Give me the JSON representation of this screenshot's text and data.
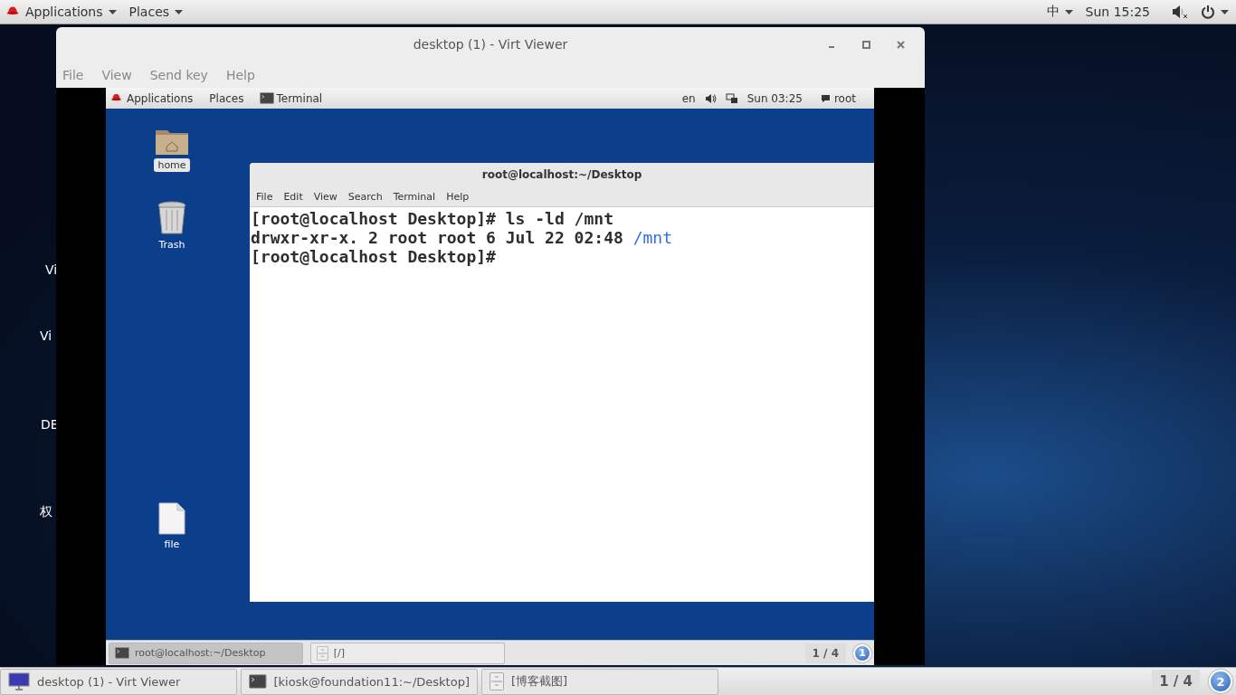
{
  "top_bar": {
    "applications": "Applications",
    "places": "Places",
    "input_method": "中",
    "clock": "Sun 15:25"
  },
  "desktop_cut_labels": [
    {
      "label": "Vi"
    },
    {
      "label": "Vi"
    },
    {
      "label": "DE"
    },
    {
      "label": "权"
    }
  ],
  "virt_viewer": {
    "title": "desktop (1) - Virt Viewer",
    "menu": [
      "File",
      "View",
      "Send key",
      "Help"
    ],
    "guest": {
      "top_bar": {
        "applications": "Applications",
        "places": "Places",
        "task": "Terminal",
        "language": "en",
        "clock": "Sun 03:25",
        "user": "root"
      },
      "desktop_icons": [
        {
          "label": "home",
          "kind": "folder",
          "selected": true
        },
        {
          "label": "Trash",
          "kind": "trash",
          "selected": false
        },
        {
          "label": "file",
          "kind": "file",
          "selected": false
        }
      ],
      "terminal": {
        "title": "root@localhost:~/Desktop",
        "menu": [
          "File",
          "Edit",
          "View",
          "Search",
          "Terminal",
          "Help"
        ],
        "lines": [
          [
            {
              "text": "[root@localhost Desktop]# ls -ld /mnt",
              "kind": "plain"
            }
          ],
          [
            {
              "text": "drwxr-xr-x. 2 root root 6 Jul 22 02:48 ",
              "kind": "plain"
            },
            {
              "text": "/mnt",
              "kind": "directory"
            }
          ],
          [
            {
              "text": "[root@localhost Desktop]#",
              "kind": "plain"
            }
          ]
        ]
      },
      "taskbar": {
        "tasks": [
          {
            "label": "root@localhost:~/Desktop",
            "kind": "terminal",
            "selected": true
          },
          {
            "label": "[/]",
            "kind": "files",
            "selected": false
          }
        ],
        "pager": "1 / 4",
        "workspace": "1"
      }
    }
  },
  "taskbar": {
    "tasks": [
      {
        "label": "desktop (1) - Virt Viewer",
        "kind": "viewer"
      },
      {
        "label": "[kiosk@foundation11:~/Desktop]",
        "kind": "terminal"
      },
      {
        "label": "[博客截图]",
        "kind": "files"
      }
    ],
    "pager": "1 / 4",
    "workspace": "2"
  }
}
